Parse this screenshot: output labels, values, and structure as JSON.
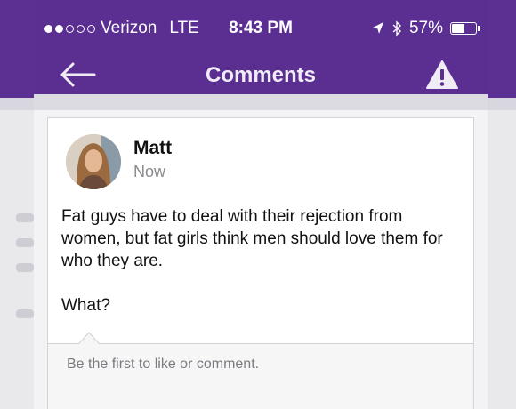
{
  "status_bar": {
    "carrier": "Verizon",
    "network": "LTE",
    "time": "8:43 PM",
    "battery": "57%",
    "battery_level": 0.57,
    "signal_bars_filled": 2,
    "signal_bars_total": 5,
    "icons": [
      "location-arrow-icon",
      "bluetooth-icon",
      "battery-icon"
    ]
  },
  "nav": {
    "title": "Comments",
    "back_icon": "back-arrow-icon",
    "report_icon": "warning-icon"
  },
  "post": {
    "author": "Matt",
    "time": "Now",
    "body": [
      "Fat guys have to deal with their rejection from women, but fat girls think men should love them for who they are.",
      "What?"
    ]
  },
  "comments": {
    "prompt": "Be the first to like or comment."
  },
  "colors": {
    "header": "#5b2e91",
    "card": "#ffffff",
    "muted_text": "#8a8a8f"
  }
}
